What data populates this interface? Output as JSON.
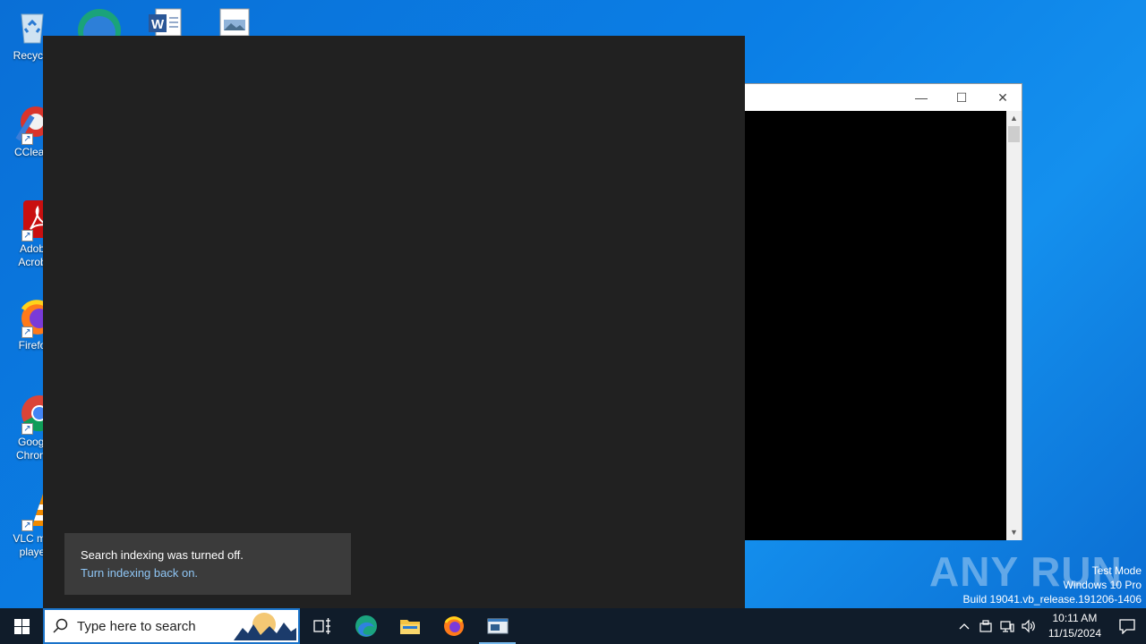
{
  "desktop": {
    "icons": [
      {
        "label": "Recycle"
      },
      {
        "label": "CClean"
      },
      {
        "label": "Adob\nAcrob"
      },
      {
        "label": "Firefo"
      },
      {
        "label": "Googl\nChrom"
      },
      {
        "label": "VLC me\nplaye"
      }
    ]
  },
  "console": {
    "min_glyph": "—",
    "max_glyph": "☐",
    "close_glyph": "✕"
  },
  "search": {
    "toast_message": "Search indexing was turned off.",
    "toast_link": "Turn indexing back on."
  },
  "watermark": {
    "brand": "ANY RUN",
    "line1": "Test Mode",
    "line2": "Windows 10 Pro",
    "line3": "Build 19041.vb_release.191206-1406"
  },
  "taskbar": {
    "search_placeholder": "Type here to search",
    "time": "10:11 AM",
    "date": "11/15/2024"
  },
  "colors": {
    "taskbar_bg": "#101c2a",
    "panel_bg": "#212121",
    "toast_bg": "#3b3b3b",
    "link": "#8fc6f5",
    "accent": "#1a73c9"
  }
}
